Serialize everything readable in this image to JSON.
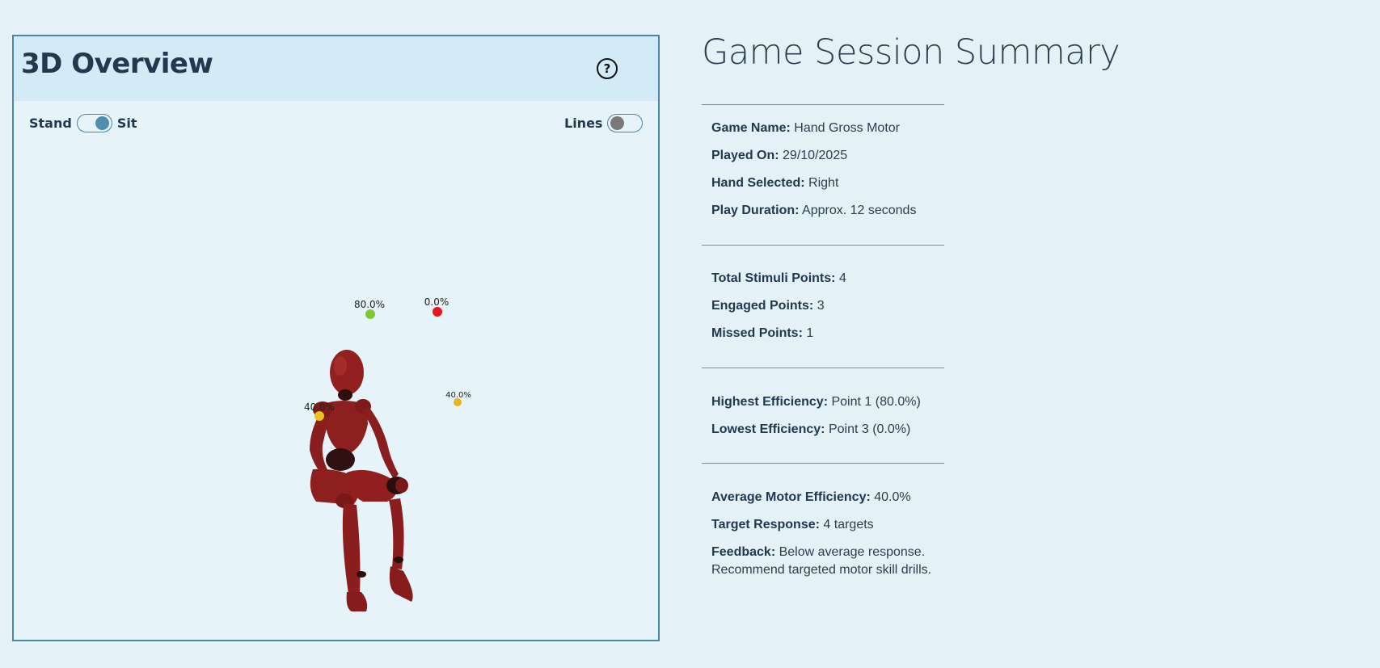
{
  "overview": {
    "title": "3D Overview",
    "help_icon": "?",
    "posture_toggle": {
      "left_label": "Stand",
      "right_label": "Sit",
      "state": "sit"
    },
    "lines_toggle": {
      "label": "Lines",
      "state": "off"
    },
    "points": [
      {
        "label": "80.0%",
        "color": "#7ec832"
      },
      {
        "label": "0.0%",
        "color": "#e8141e"
      },
      {
        "label": "40.0%",
        "color": "#e8c41a"
      },
      {
        "label": "40.0%",
        "color": "#e2b818"
      }
    ],
    "figure_color": "#8e1f1f"
  },
  "summary": {
    "title": "Game Session Summary",
    "game_name": {
      "label": "Game Name:",
      "value": "Hand Gross Motor"
    },
    "played_on": {
      "label": "Played On:",
      "value": "29/10/2025"
    },
    "hand_selected": {
      "label": "Hand Selected:",
      "value": "Right"
    },
    "play_duration": {
      "label": "Play Duration:",
      "value": "Approx. 12 seconds"
    },
    "total_points": {
      "label": "Total Stimuli Points:",
      "value": "4"
    },
    "engaged_points": {
      "label": "Engaged Points:",
      "value": "3"
    },
    "missed_points": {
      "label": "Missed Points:",
      "value": "1"
    },
    "highest": {
      "label": "Highest Efficiency:",
      "value": "Point 1 (80.0%)"
    },
    "lowest": {
      "label": "Lowest Efficiency:",
      "value": "Point 3 (0.0%)"
    },
    "average": {
      "label": "Average Motor Efficiency:",
      "value": "40.0%"
    },
    "target_response": {
      "label": "Target Response:",
      "value": "4 targets"
    },
    "feedback": {
      "label": "Feedback:",
      "value": "Below average response. Recommend targeted motor skill drills."
    }
  }
}
